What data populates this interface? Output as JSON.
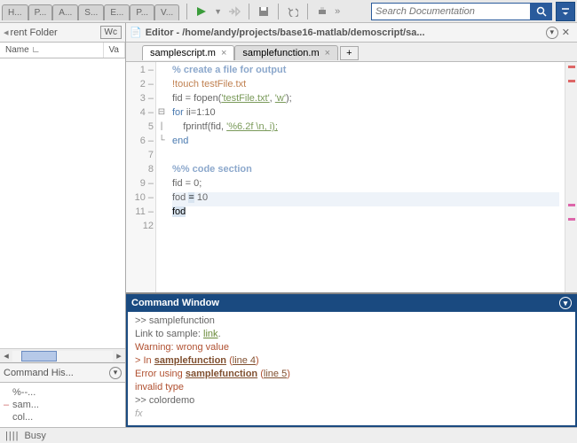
{
  "topTabs": [
    "H...",
    "P...",
    "A...",
    "S...",
    "E...",
    "P...",
    "V..."
  ],
  "search": {
    "placeholder": "Search Documentation"
  },
  "leftPanel": {
    "folderTitle": "rent Folder",
    "folderSideTab": "Wc",
    "cols": {
      "name": "Name ∟",
      "value": "Va"
    },
    "historyTitle": "Command His...",
    "history": [
      "%--...",
      "sam...",
      "col..."
    ]
  },
  "editor": {
    "title": "Editor - /home/andy/projects/base16-matlab/demoscript/sa...",
    "tabs": [
      {
        "label": "samplescript.m",
        "active": true
      },
      {
        "label": "samplefunction.m",
        "active": false
      }
    ],
    "code": {
      "comment1": "% create a file for output",
      "bang": "!touch testFile.txt",
      "l3a": "fid = fopen(",
      "l3str": "'testFile.txt'",
      "l3b": ", ",
      "l3str2": "'w'",
      "l3c": ");",
      "l4kw": "for",
      "l4rest": " ii=1:10",
      "l5a": "    fprintf(fid, ",
      "l5str": "'%6.2f \\n, i);",
      "l6kw": "end",
      "section": "%% code section",
      "l9": "fid = 0;",
      "l10a": "fod ",
      "l10b": "=",
      "l10c": " 10",
      "l11": "fod"
    }
  },
  "commandWindow": {
    "title": "Command Window",
    "lines": {
      "p1": ">> ",
      "in1": "samplefunction",
      "t2a": "Link to sample: ",
      "t2link": "link",
      "t2b": ".",
      "w3": "Warning: wrong value",
      "w4a": "> In ",
      "w4fn": "samplefunction",
      "w4b": " (",
      "w4ln": "line 4",
      "w4c": ")",
      "e5a": "Error using ",
      "e5fn": "samplefunction",
      "e5b": " (",
      "e5ln": "line 5",
      "e5c": ")",
      "e6": "invalid type",
      "p2": ">> ",
      "in2": "colordemo",
      "fx": "fx"
    }
  },
  "status": {
    "indicator": "||||",
    "text": "Busy"
  }
}
